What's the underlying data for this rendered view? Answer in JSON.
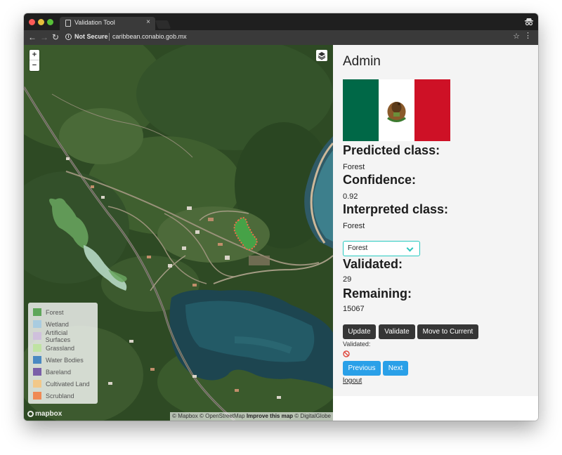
{
  "browser": {
    "tab_title": "Validation Tool",
    "tab_close": "×",
    "security_label": "Not Secure",
    "url": "caribbean.conabio.gob.mx",
    "colors": {
      "titlebar": "#1f1f1f",
      "toolbar": "#3a3a3a"
    }
  },
  "map": {
    "zoom_in": "+",
    "zoom_out": "−",
    "attribution": {
      "mapbox": "© Mapbox",
      "osm": "© OpenStreetMap",
      "improve": "Improve this map",
      "digitalglobe": "© DigitalGlobe"
    },
    "logo_text": "mapbox",
    "legend": [
      {
        "label": "Forest",
        "color": "#5fa65a"
      },
      {
        "label": "Wetland",
        "color": "#a9cce0"
      },
      {
        "label": "Artificial Surfaces",
        "color": "#cfc0dc"
      },
      {
        "label": "Grassland",
        "color": "#bfe3a2"
      },
      {
        "label": "Water Bodies",
        "color": "#4a89c2"
      },
      {
        "label": "Bareland",
        "color": "#7a5fa8"
      },
      {
        "label": "Cultivated Land",
        "color": "#f2c889"
      },
      {
        "label": "Scrubland",
        "color": "#f08a54"
      }
    ]
  },
  "panel": {
    "title": "Admin",
    "predicted_class_label": "Predicted class:",
    "predicted_class_value": "Forest",
    "confidence_label": "Confidence:",
    "confidence_value": "0.92",
    "interpreted_class_label": "Interpreted class:",
    "interpreted_class_value": "Forest",
    "select_value": "Forest",
    "validated_label": "Validated:",
    "validated_value": "29",
    "remaining_label": "Remaining:",
    "remaining_value": "15067",
    "buttons": {
      "update": "Update",
      "validate": "Validate",
      "move_to_current": "Move to Current",
      "previous": "Previous",
      "next": "Next"
    },
    "validated_small_label": "Validated:",
    "logout": "logout",
    "colors": {
      "accent": "#27c9c0",
      "primary_button": "#2aa0e8",
      "dark_button": "#363636",
      "not_validated": "#e0453a"
    }
  }
}
